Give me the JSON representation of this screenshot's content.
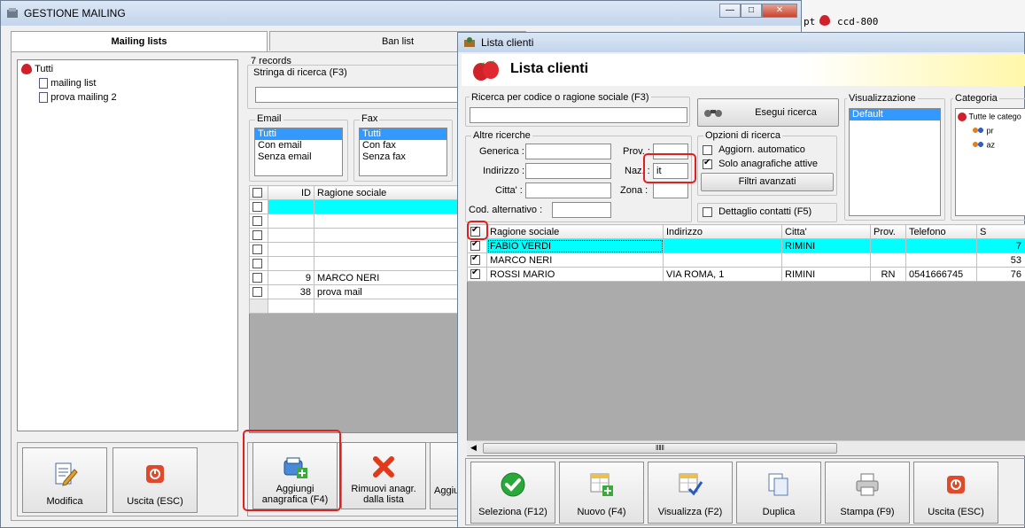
{
  "main_window": {
    "title": "GESTIONE MAILING",
    "tabs": [
      "Mailing lists",
      "Ban list"
    ],
    "tree": {
      "root": "Tutti",
      "children": [
        "mailing list",
        "prova mailing 2"
      ]
    },
    "records": "7 records",
    "search_label": "Stringa di ricerca (F3)",
    "email_group": {
      "label": "Email",
      "items": [
        "Tutti",
        "Con email",
        "Senza email"
      ]
    },
    "fax_group": {
      "label": "Fax",
      "items": [
        "Tutti",
        "Con fax",
        "Senza fax"
      ]
    },
    "grid": {
      "headers": [
        "ID",
        "Ragione sociale"
      ],
      "rows": [
        [
          "",
          ""
        ],
        [
          "",
          ""
        ],
        [
          "",
          ""
        ],
        [
          "",
          ""
        ],
        [
          "",
          ""
        ],
        [
          "9",
          "MARCO NERI"
        ],
        [
          "38",
          "prova mail"
        ]
      ]
    },
    "buttons": {
      "modifica": "Modifica",
      "uscita": "Uscita (ESC)",
      "aggiungi": "Aggiungi anagrafica (F4)",
      "rimuovi": "Rimuovi anagr. dalla lista",
      "aggiu_partial": "Aggiu"
    }
  },
  "background_taskbar": {
    "text": "ccd-800",
    "partial": "pt"
  },
  "dialog": {
    "title": "Lista clienti",
    "header_title": "Lista clienti",
    "search_code_label": "Ricerca per codice o ragione sociale (F3)",
    "esegui_button": "Esegui ricerca",
    "altre_ricerche": "Altre ricerche",
    "fields": {
      "generica": "Generica :",
      "indirizzo": "Indirizzo :",
      "citta": "Citta' :",
      "cod_alt": "Cod. alternativo :",
      "prov": "Prov. :",
      "naz": "Naz. :",
      "naz_value": "it",
      "zona": "Zona :"
    },
    "opzioni": {
      "label": "Opzioni di ricerca",
      "aggiorn": "Aggiorn. automatico",
      "solo": "Solo anagrafiche attive",
      "filtri": "Filtri avanzati",
      "dettaglio": "Dettaglio contatti (F5)"
    },
    "visualizzazione": {
      "label": "Visualizzazione",
      "items": [
        "Default"
      ]
    },
    "categoria": {
      "label": "Categoria",
      "root": "Tutte le catego",
      "items": [
        "pr",
        "az"
      ]
    },
    "grid": {
      "headers": [
        "Ragione sociale",
        "Indirizzo",
        "Citta'",
        "Prov.",
        "Telefono",
        "S"
      ],
      "rows": [
        [
          "FABIO VERDI",
          "",
          "RIMINI",
          "",
          "",
          "7"
        ],
        [
          "MARCO NERI",
          "",
          "",
          "",
          "",
          "53"
        ],
        [
          "ROSSI MARIO",
          "VIA ROMA, 1",
          "RIMINI",
          "RN",
          "0541666745",
          "76"
        ]
      ]
    },
    "buttons": {
      "seleziona": "Seleziona (F12)",
      "nuovo": "Nuovo (F4)",
      "visualizza": "Visualizza (F2)",
      "duplica": "Duplica",
      "stampa": "Stampa (F9)",
      "uscita": "Uscita (ESC)"
    }
  },
  "colors": {
    "selected_row": "#00ffff",
    "highlight_box": "#e02020",
    "list_selection": "#3399ff"
  }
}
